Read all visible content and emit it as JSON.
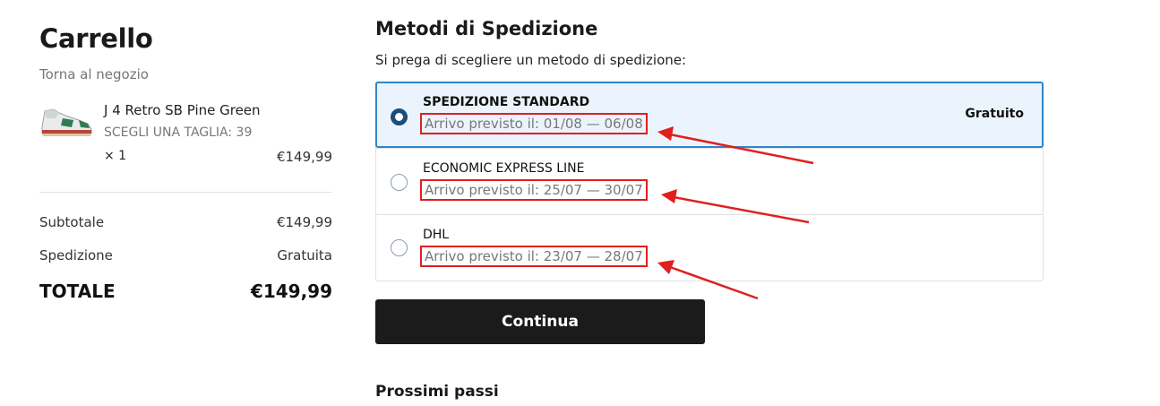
{
  "cart": {
    "title": "Carrello",
    "back_link": "Torna al negozio",
    "item": {
      "image_icon": "sneaker-image",
      "name": "J 4 Retro SB Pine Green",
      "size": "SCEGLI UNA TAGLIA: 39",
      "quantity": "× 1",
      "price": "€149,99"
    },
    "summary": {
      "subtotal_label": "Subtotale",
      "subtotal_value": "€149,99",
      "shipping_label": "Spedizione",
      "shipping_value": "Gratuita",
      "total_label": "TOTALE",
      "total_value": "€149,99"
    }
  },
  "shipping": {
    "title": "Metodi di Spedizione",
    "subtitle": "Si prega di scegliere un metodo di spedizione:",
    "methods": [
      {
        "name": "SPEDIZIONE STANDARD",
        "eta": "Arrivo previsto il: 01/08 — 06/08",
        "price": "Gratuito",
        "selected": true
      },
      {
        "name": "ECONOMIC EXPRESS LINE",
        "eta": "Arrivo previsto il: 25/07 — 30/07",
        "price": "",
        "selected": false
      },
      {
        "name": "DHL",
        "eta": "Arrivo previsto il: 23/07 — 28/07",
        "price": "",
        "selected": false
      }
    ],
    "continue_label": "Continua",
    "next_steps": "Prossimi passi"
  },
  "colors": {
    "selected_bg": "#ebf4fc",
    "selected_border": "#2f86c6",
    "annotation_red": "#e01f1f",
    "button_bg": "#1b1b1b"
  }
}
